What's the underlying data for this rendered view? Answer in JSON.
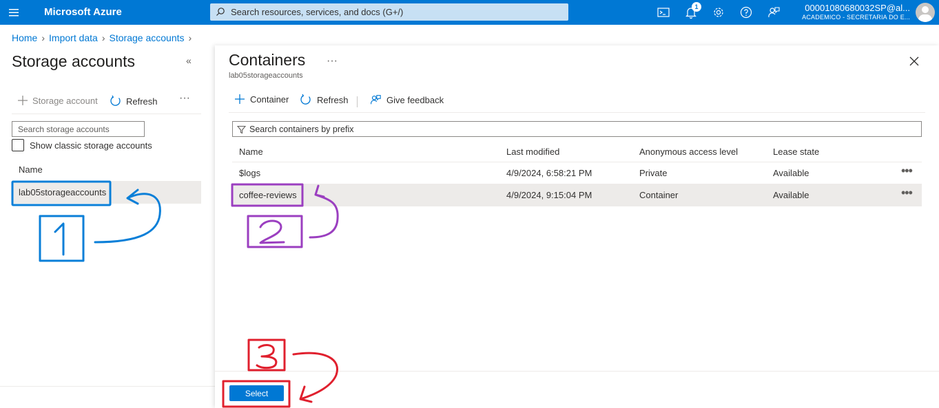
{
  "topbar": {
    "brand": "Microsoft Azure",
    "search_placeholder": "Search resources, services, and docs (G+/)",
    "notification_count": "1",
    "user": "00001080680032SP@al...",
    "org": "ACADEMICO - SECRETARIA DO E..."
  },
  "breadcrumb": [
    "Home",
    "Import data",
    "Storage accounts"
  ],
  "left": {
    "title": "Storage accounts",
    "collapse": "«",
    "add_label": "Storage account",
    "refresh_label": "Refresh",
    "more": "···",
    "search_placeholder": "Search storage accounts",
    "classic_label": "Show classic storage accounts",
    "name_header": "Name",
    "selected_account": "lab05storageaccounts"
  },
  "panel": {
    "title": "Containers",
    "more": "···",
    "subtitle": "lab05storageaccounts",
    "toolbar": {
      "container": "Container",
      "refresh": "Refresh",
      "feedback": "Give feedback"
    },
    "search_placeholder": "Search containers by prefix",
    "columns": [
      "Name",
      "Last modified",
      "Anonymous access level",
      "Lease state"
    ],
    "rows": [
      {
        "name": "$logs",
        "modified": "4/9/2024, 6:58:21 PM",
        "access": "Private",
        "lease": "Available",
        "more": "•••"
      },
      {
        "name": "coffee-reviews",
        "modified": "4/9/2024, 9:15:04 PM",
        "access": "Container",
        "lease": "Available",
        "more": "•••"
      }
    ],
    "select_label": "Select"
  },
  "annotations": {
    "step1": "1",
    "step2": "2",
    "step3": "3",
    "colors": {
      "step1": "#0a7fd8",
      "step2": "#9b3fc0",
      "step3": "#e0202e"
    }
  }
}
